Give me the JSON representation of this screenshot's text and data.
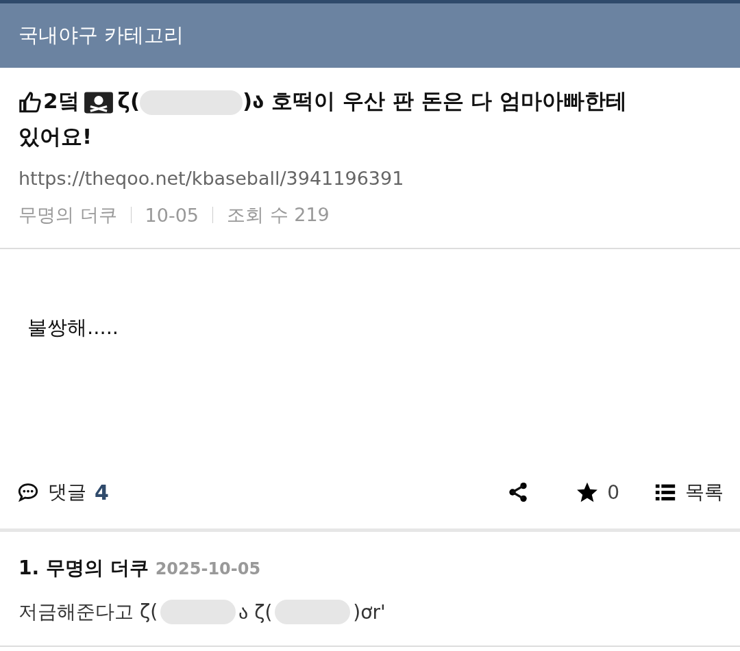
{
  "header": {
    "title": "국내야구 카테고리"
  },
  "post": {
    "title_prefix": "2덬",
    "title_open": "ζ(",
    "title_rest": ")ა 호떡이 우산 판 돈은 다 엄마아빠한테",
    "title_end": "있어요!",
    "url": "https://theqoo.net/kbaseball/3941196391",
    "author": "무명의 더쿠",
    "date": "10-05",
    "views": "조회 수 219",
    "body": "불쌍해....."
  },
  "actions": {
    "comment_label": "댓글",
    "comment_count": "4",
    "star_count": "0",
    "list_label": "목록"
  },
  "comments": [
    {
      "number": "1.",
      "author": "무명의 더쿠",
      "date": "2025-10-05",
      "parts": [
        "저금해준다고 ζ(",
        "ა ζ(",
        ")ơr'"
      ]
    }
  ]
}
